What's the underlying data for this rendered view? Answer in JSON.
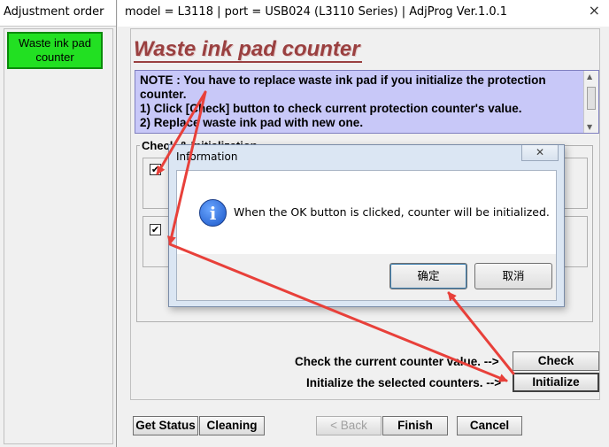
{
  "left_window": {
    "title": "Adjustment order",
    "waste_ink_button": "Waste ink pad counter"
  },
  "main_window": {
    "title": "model = L3118 | port = USB024 (L3110 Series) | AdjProg Ver.1.0.1",
    "close_glyph": "×",
    "heading": "Waste ink pad counter",
    "note": {
      "line1": "NOTE : You have to replace waste ink pad if you initialize the protection",
      "line2": "counter.",
      "line3": "1) Click [Check] button to check current protection counter's value.",
      "line4": "2) Replace waste ink pad with new one."
    },
    "group_label": "Check & Initialization",
    "checkbox_1_checked": true,
    "checkbox_2_checked": true,
    "check_label": "Check the current counter value. -->",
    "check_button": "Check",
    "initialize_label": "Initialize the selected counters. -->",
    "initialize_button": "Initialize",
    "bottom_buttons": {
      "get_status": "Get Status",
      "cleaning": "Cleaning",
      "back": "< Back",
      "finish": "Finish",
      "cancel": "Cancel"
    }
  },
  "dialog": {
    "title": "Information",
    "close_glyph": "✕",
    "icon": "info-icon",
    "message": "When the OK button is clicked, counter will be initialized.",
    "ok_button": "确定",
    "cancel_button": "取消"
  },
  "colors": {
    "heading": "#9a4040",
    "note_bg": "#c8c8f8",
    "green_button": "#22e022",
    "arrow": "#e8403a"
  }
}
